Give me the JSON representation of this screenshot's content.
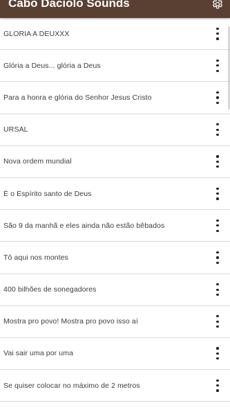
{
  "app_bar": {
    "title": "Cabo Daciolo Sounds",
    "settings_icon": "gear-icon"
  },
  "colors": {
    "app_bar_bg": "#5a3f33",
    "divider": "#d9d9d9",
    "text": "#3c3c3c"
  },
  "sounds": [
    {
      "label": "GLORIA A DEUXXX",
      "menu_icon": "more-vertical-icon"
    },
    {
      "label": "Glória a Deus... glória a Deus",
      "menu_icon": "more-vertical-icon"
    },
    {
      "label": "Para a honra e glória do Senhor Jesus Cristo",
      "menu_icon": "more-vertical-icon"
    },
    {
      "label": "URSAL",
      "menu_icon": "more-vertical-icon"
    },
    {
      "label": "Nova ordem mundial",
      "menu_icon": "more-vertical-icon"
    },
    {
      "label": "É o Espírito santo de Deus",
      "menu_icon": "more-vertical-icon"
    },
    {
      "label": "São 9 da manhã e eles ainda não estão bêbados",
      "menu_icon": "more-vertical-icon"
    },
    {
      "label": "Tô aqui nos montes",
      "menu_icon": "more-vertical-icon"
    },
    {
      "label": "400 bilhões de sonegadores",
      "menu_icon": "more-vertical-icon"
    },
    {
      "label": "Mostra pro povo! Mostra pro povo isso aí",
      "menu_icon": "more-vertical-icon"
    },
    {
      "label": "Vai sair uma por uma",
      "menu_icon": "more-vertical-icon"
    },
    {
      "label": "Se quiser colocar no máximo de 2 metros",
      "menu_icon": "more-vertical-icon"
    }
  ]
}
